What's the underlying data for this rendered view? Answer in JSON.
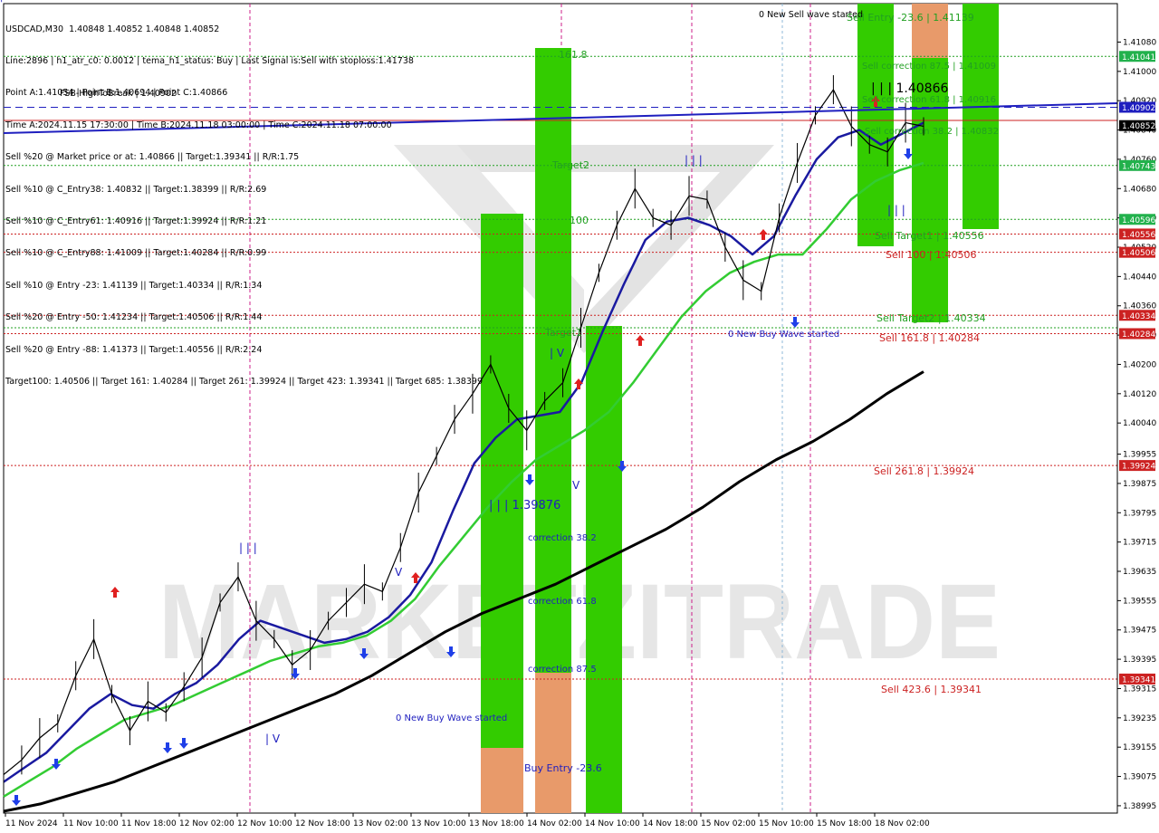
{
  "info": {
    "header": "USDCAD,M30  1.40848 1.40852 1.40848 1.40852",
    "lines": [
      "Line:2896 | h1_atr_c0: 0.0012 | tema_h1_status: Buy | Last Signal is:Sell with stoploss:1.41738",
      "Point A:1.41054 | Point B:1.40694 | Point C:1.40866",
      "Time A:2024.11.15 17:30:00 | Time B:2024.11.18 03:00:00 | Time C:2024.11.18 07:00:00",
      "Sell %20 @ Market price or at: 1.40866 || Target:1.39341 || R/R:1.75",
      "Sell %10 @ C_Entry38: 1.40832 || Target:1.38399 || R/R:2.69",
      "Sell %10 @ C_Entry61: 1.40916 || Target:1.39924 || R/R:1.21",
      "Sell %10 @ C_Entry88: 1.41009 || Target:1.40284 || R/R:0.99",
      "Sell %10 @ Entry -23: 1.41139 || Target:1.40334 || R/R:1.34",
      "Sell %20 @ Entry -50: 1.41234 || Target:1.40506 || R/R:1.44",
      "Sell %20 @ Entry -88: 1.41373 || Target:1.40556 || R/R:2.24",
      "Target100: 1.40506 || Target 161: 1.40284 || Target 261: 1.39924 || Target 423: 1.39341 || Target 685: 1.38399"
    ],
    "overlay": "FSB-HighToBreak | 1.40902"
  },
  "chart_data": {
    "type": "line",
    "symbol": "USDCAD,M30",
    "ylim": [
      1.38975,
      1.41185
    ],
    "y_ticks": [
      "1.41080",
      "1.41000",
      "1.40920",
      "1.40840",
      "1.40760",
      "1.40680",
      "1.40600",
      "1.40520",
      "1.40440",
      "1.40360",
      "1.40280",
      "1.40200",
      "1.40120",
      "1.40040",
      "1.39955",
      "1.39875",
      "1.39795",
      "1.39715",
      "1.39635",
      "1.39555",
      "1.39475",
      "1.39395",
      "1.39315",
      "1.39235",
      "1.39155",
      "1.39075",
      "1.38995"
    ],
    "x_ticks": [
      "11 Nov 2024",
      "11 Nov 10:00",
      "11 Nov 18:00",
      "12 Nov 02:00",
      "12 Nov 10:00",
      "12 Nov 18:00",
      "13 Nov 02:00",
      "13 Nov 10:00",
      "13 Nov 18:00",
      "14 Nov 02:00",
      "14 Nov 10:00",
      "14 Nov 18:00",
      "15 Nov 02:00",
      "15 Nov 10:00",
      "15 Nov 18:00",
      "18 Nov 02:00"
    ],
    "price_labels": [
      {
        "text": "1.41041",
        "value": 1.41041,
        "color": "#22b14c"
      },
      {
        "text": "1.40902",
        "value": 1.40902,
        "color": "#1f1fbf"
      },
      {
        "text": "1.40852",
        "value": 1.40852,
        "color": "#000000"
      },
      {
        "text": "1.40743",
        "value": 1.40743,
        "color": "#22b14c"
      },
      {
        "text": "1.40596",
        "value": 1.40596,
        "color": "#22b14c"
      },
      {
        "text": "1.40556",
        "value": 1.40556,
        "color": "#cc2222"
      },
      {
        "text": "1.40506",
        "value": 1.40506,
        "color": "#cc2222"
      },
      {
        "text": "1.40334",
        "value": 1.40334,
        "color": "#cc2222"
      },
      {
        "text": "1.40284",
        "value": 1.40284,
        "color": "#cc2222"
      },
      {
        "text": "1.39924",
        "value": 1.39924,
        "color": "#cc2222"
      },
      {
        "text": "1.39341",
        "value": 1.39341,
        "color": "#cc2222"
      }
    ],
    "levels": [
      {
        "value": 1.41041,
        "color": "#22a022",
        "style": "dot"
      },
      {
        "value": 1.40902,
        "color": "#1f1fbf",
        "style": "dash"
      },
      {
        "value": 1.40743,
        "color": "#22a022",
        "style": "dot"
      },
      {
        "value": 1.40596,
        "color": "#22a022",
        "style": "dot"
      },
      {
        "value": 1.40556,
        "color": "#cc2222",
        "style": "dot"
      },
      {
        "value": 1.40506,
        "color": "#cc2222",
        "style": "dot"
      },
      {
        "value": 1.40334,
        "color": "#cc2222",
        "style": "dot"
      },
      {
        "value": 1.403,
        "color": "#22a022",
        "style": "dot"
      },
      {
        "value": 1.40284,
        "color": "#cc2222",
        "style": "dot"
      },
      {
        "value": 1.39924,
        "color": "#cc2222",
        "style": "dot"
      },
      {
        "value": 1.39341,
        "color": "#cc2222",
        "style": "dot"
      }
    ],
    "annotations": [
      {
        "text": "0 New Sell wave started",
        "color": "#000000"
      },
      {
        "text": "Sell Entry -23.6 | 1.41139",
        "color": "#22a022"
      },
      {
        "text": "Sell correction 87.5 | 1.41009",
        "color": "#22a022"
      },
      {
        "text": "| | | 1.40866",
        "color": "#000000"
      },
      {
        "text": "Sell correction 61.8 | 1.40916",
        "color": "#22a022"
      },
      {
        "text": "Sell correction 38.2 | 1.40832",
        "color": "#22a022"
      },
      {
        "text": "Sell Target1 | 1.40556",
        "color": "#22a022"
      },
      {
        "text": "Sell 100 | 1.40506",
        "color": "#cc2222"
      },
      {
        "text": "Sell Target2 | 1.40334",
        "color": "#22a022"
      },
      {
        "text": "Sell 161.8 | 1.40284",
        "color": "#cc2222"
      },
      {
        "text": "Sell 261.8 | 1.39924",
        "color": "#cc2222"
      },
      {
        "text": "Sell 423.6 | 1.39341",
        "color": "#cc2222"
      },
      {
        "text": "0 New Buy Wave started",
        "color": "#1f1fbf"
      },
      {
        "text": "0 New Buy Wave started",
        "color": "#1f1fbf"
      },
      {
        "text": "| | | 1.39876",
        "color": "#1f1fbf"
      },
      {
        "text": "correction 38.2",
        "color": "#1f1fbf"
      },
      {
        "text": "correction 61.8",
        "color": "#1f1fbf"
      },
      {
        "text": "correction 87.5",
        "color": "#1f1fbf"
      },
      {
        "text": "Buy Entry -23.6",
        "color": "#1f1fbf"
      },
      {
        "text": "161.8",
        "color": "#22a022"
      },
      {
        "text": "Target2",
        "color": "#22a022"
      },
      {
        "text": "100",
        "color": "#22a022"
      },
      {
        "text": "Target1",
        "color": "#22a022"
      },
      {
        "text": "| | |",
        "color": "#1f1fbf"
      },
      {
        "text": "| V",
        "color": "#1f1fbf"
      },
      {
        "text": "V",
        "color": "#1f1fbf"
      },
      {
        "text": "| | |",
        "color": "#1f1fbf"
      },
      {
        "text": "| V",
        "color": "#1f1fbf"
      },
      {
        "text": "V",
        "color": "#1f1fbf"
      },
      {
        "text": "| | |",
        "color": "#1f1fbf"
      },
      {
        "text": "| V",
        "color": "#1f1fbf"
      }
    ],
    "watermark": "MARKETZITRADE",
    "price_path": [
      1.3908,
      1.3912,
      1.3918,
      1.3922,
      1.3935,
      1.3945,
      1.393,
      1.392,
      1.3928,
      1.3925,
      1.3932,
      1.394,
      1.3955,
      1.3962,
      1.395,
      1.3945,
      1.3938,
      1.3942,
      1.395,
      1.3955,
      1.396,
      1.3958,
      1.397,
      1.3985,
      1.3995,
      1.4005,
      1.4012,
      1.402,
      1.4008,
      1.4002,
      1.401,
      1.4015,
      1.403,
      1.4045,
      1.4058,
      1.4068,
      1.406,
      1.4058,
      1.4066,
      1.4065,
      1.4052,
      1.4043,
      1.404,
      1.406,
      1.4075,
      1.4088,
      1.4095,
      1.4085,
      1.408,
      1.4078,
      1.4086,
      1.4085
    ],
    "series": [
      {
        "values": [
          1.3906,
          1.391,
          1.3914,
          1.392,
          1.3926,
          1.393,
          1.3927,
          1.3926,
          1.393,
          1.3933,
          1.3938,
          1.3945,
          1.395,
          1.3948,
          1.3946,
          1.3944,
          1.3945,
          1.3947,
          1.3951,
          1.3957,
          1.3966,
          1.398,
          1.3993,
          1.4,
          1.4005,
          1.4006,
          1.4007,
          1.4015,
          1.4029,
          1.4042,
          1.4054,
          1.4059,
          1.406,
          1.4058,
          1.4055,
          1.405,
          1.4055,
          1.4066,
          1.4076,
          1.4082,
          1.4084,
          1.408,
          1.4083,
          1.4086
        ],
        "color": "#1a1aa0"
      },
      {
        "values": [
          1.3902,
          1.3906,
          1.391,
          1.3915,
          1.3919,
          1.3923,
          1.3925,
          1.3927,
          1.393,
          1.3933,
          1.3936,
          1.3939,
          1.3941,
          1.3943,
          1.3944,
          1.3946,
          1.395,
          1.3956,
          1.3965,
          1.3973,
          1.3981,
          1.3988,
          1.3994,
          1.3998,
          1.4002,
          1.4007,
          1.4015,
          1.4024,
          1.4033,
          1.404,
          1.4045,
          1.4048,
          1.405,
          1.405,
          1.4057,
          1.4065,
          1.407,
          1.4073,
          1.4075
        ],
        "color": "#33cc33"
      },
      {
        "values": [
          1.3898,
          1.39,
          1.3903,
          1.3906,
          1.391,
          1.3914,
          1.3918,
          1.3922,
          1.3926,
          1.393,
          1.3935,
          1.3941,
          1.3947,
          1.3952,
          1.3956,
          1.396,
          1.3965,
          1.397,
          1.3975,
          1.3981,
          1.3988,
          1.3994,
          1.3999,
          1.4005,
          1.4012,
          1.4018
        ],
        "color": "#000000"
      }
    ]
  }
}
